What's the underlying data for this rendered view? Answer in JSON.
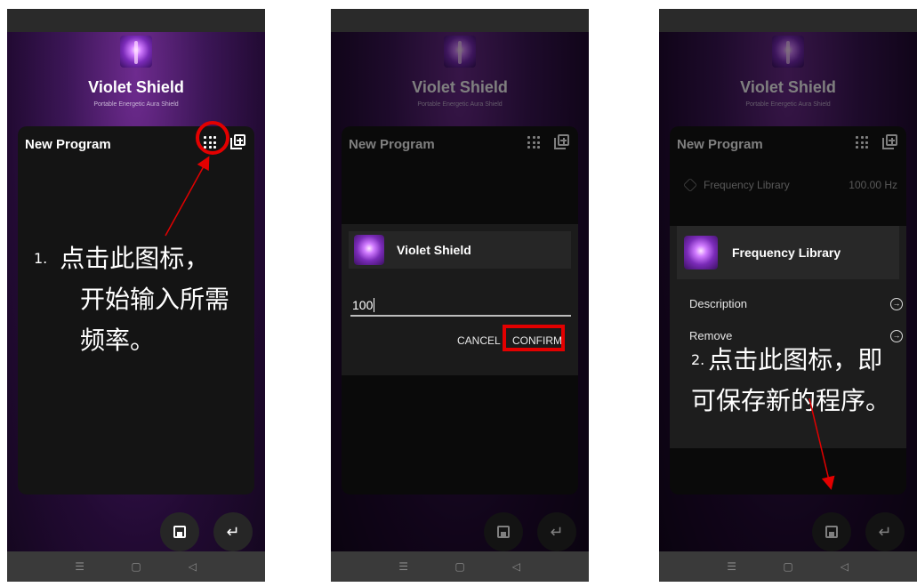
{
  "app": {
    "title": "Violet Shield",
    "subtitle": "Portable Energetic Aura Shield",
    "card_title": "New Program"
  },
  "step1": {
    "number": "1.",
    "text_line1": "点击此图标，",
    "text_line2": "开始输入所需",
    "text_line3": "频率。"
  },
  "dialog": {
    "title": "Violet Shield",
    "input_value": "100",
    "cancel_label": "CANCEL",
    "confirm_label": "CONFIRM"
  },
  "library": {
    "row_label": "Frequency Library",
    "row_value": "100.00 Hz",
    "panel_title": "Frequency Library",
    "menu": [
      "Description",
      "Remove"
    ]
  },
  "step2": {
    "number": "2.",
    "text_line1": "点击此图标，即",
    "text_line2": "可保存新的程序。"
  },
  "icons": {
    "nav_menu": "menu-lines-icon",
    "nav_home": "home-square-icon",
    "nav_back": "back-triangle-icon",
    "save": "save-icon",
    "enter": "enter-icon"
  },
  "colors": {
    "accent_red": "#e30000",
    "background_purple": "#3c1657"
  }
}
